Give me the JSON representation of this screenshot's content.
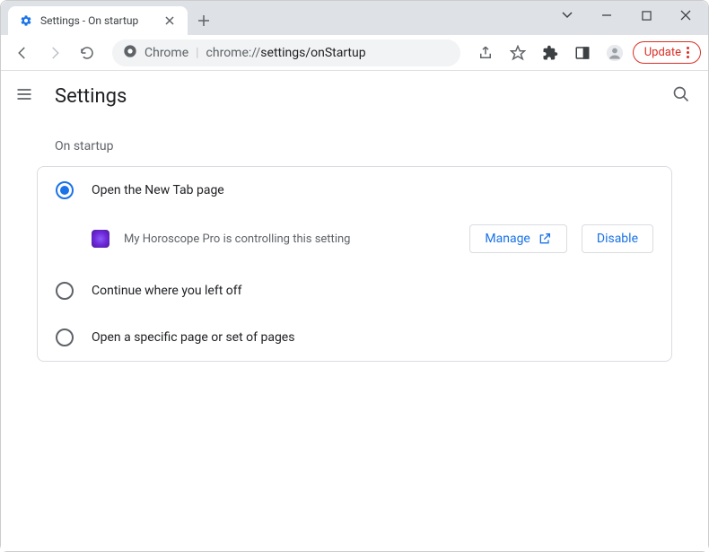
{
  "window": {
    "tab_title": "Settings - On startup"
  },
  "omnibox": {
    "scheme_label": "Chrome",
    "origin": "chrome://",
    "path": "settings/onStartup"
  },
  "toolbar": {
    "update_label": "Update"
  },
  "settings": {
    "title": "Settings",
    "section_label": "On startup",
    "options": [
      {
        "label": "Open the New Tab page",
        "selected": true
      },
      {
        "label": "Continue where you left off",
        "selected": false
      },
      {
        "label": "Open a specific page or set of pages",
        "selected": false
      }
    ],
    "extension_notice": "My Horoscope Pro is controlling this setting",
    "manage_label": "Manage",
    "disable_label": "Disable"
  }
}
